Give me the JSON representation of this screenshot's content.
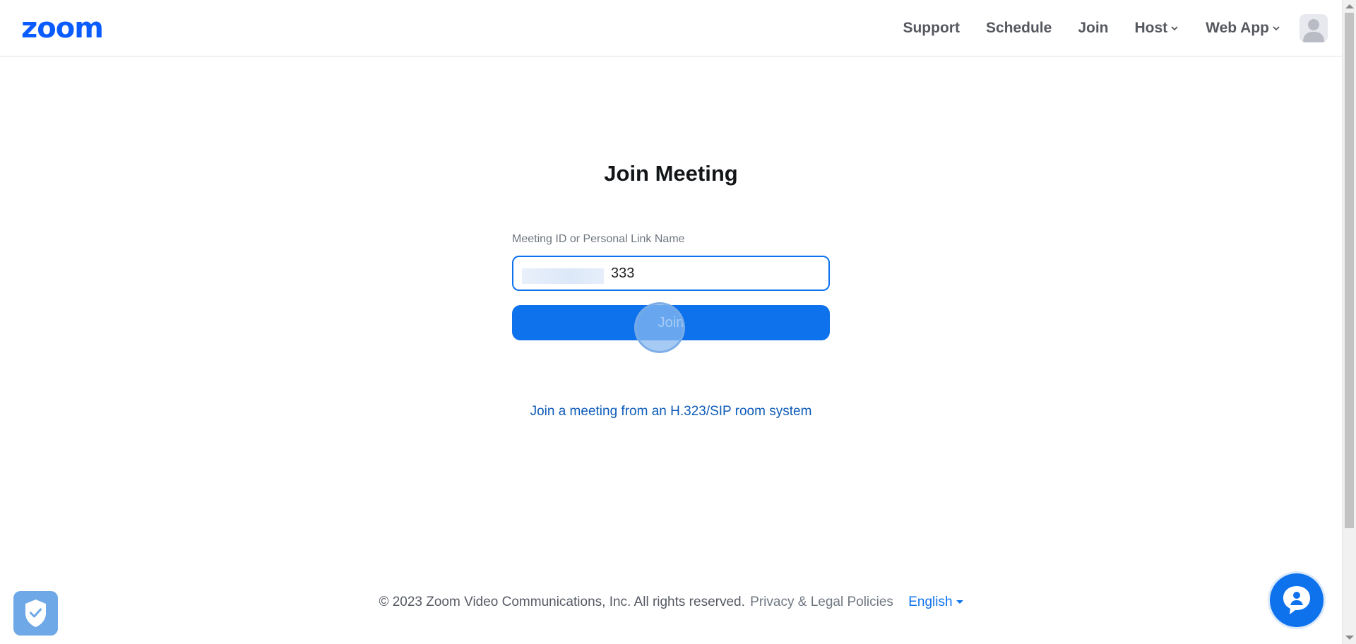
{
  "header": {
    "logo_text": "zoom",
    "nav": {
      "support": "Support",
      "schedule": "Schedule",
      "join": "Join",
      "host": "Host",
      "web_app": "Web App"
    }
  },
  "main": {
    "title": "Join Meeting",
    "field_label": "Meeting ID or Personal Link Name",
    "input_value": "333",
    "join_button": "Join",
    "sip_link": "Join a meeting from an H.323/SIP room system"
  },
  "footer": {
    "copyright": "© 2023 Zoom Video Communications, Inc. All rights reserved.",
    "privacy": "Privacy & Legal Policies",
    "language": "English"
  },
  "icons": {
    "shield": "shield-check-icon",
    "chat": "chat-bot-icon",
    "avatar": "user-avatar-icon"
  },
  "colors": {
    "brand": "#0b5cff",
    "primary": "#0e72ed",
    "nav_text": "#56585f"
  }
}
